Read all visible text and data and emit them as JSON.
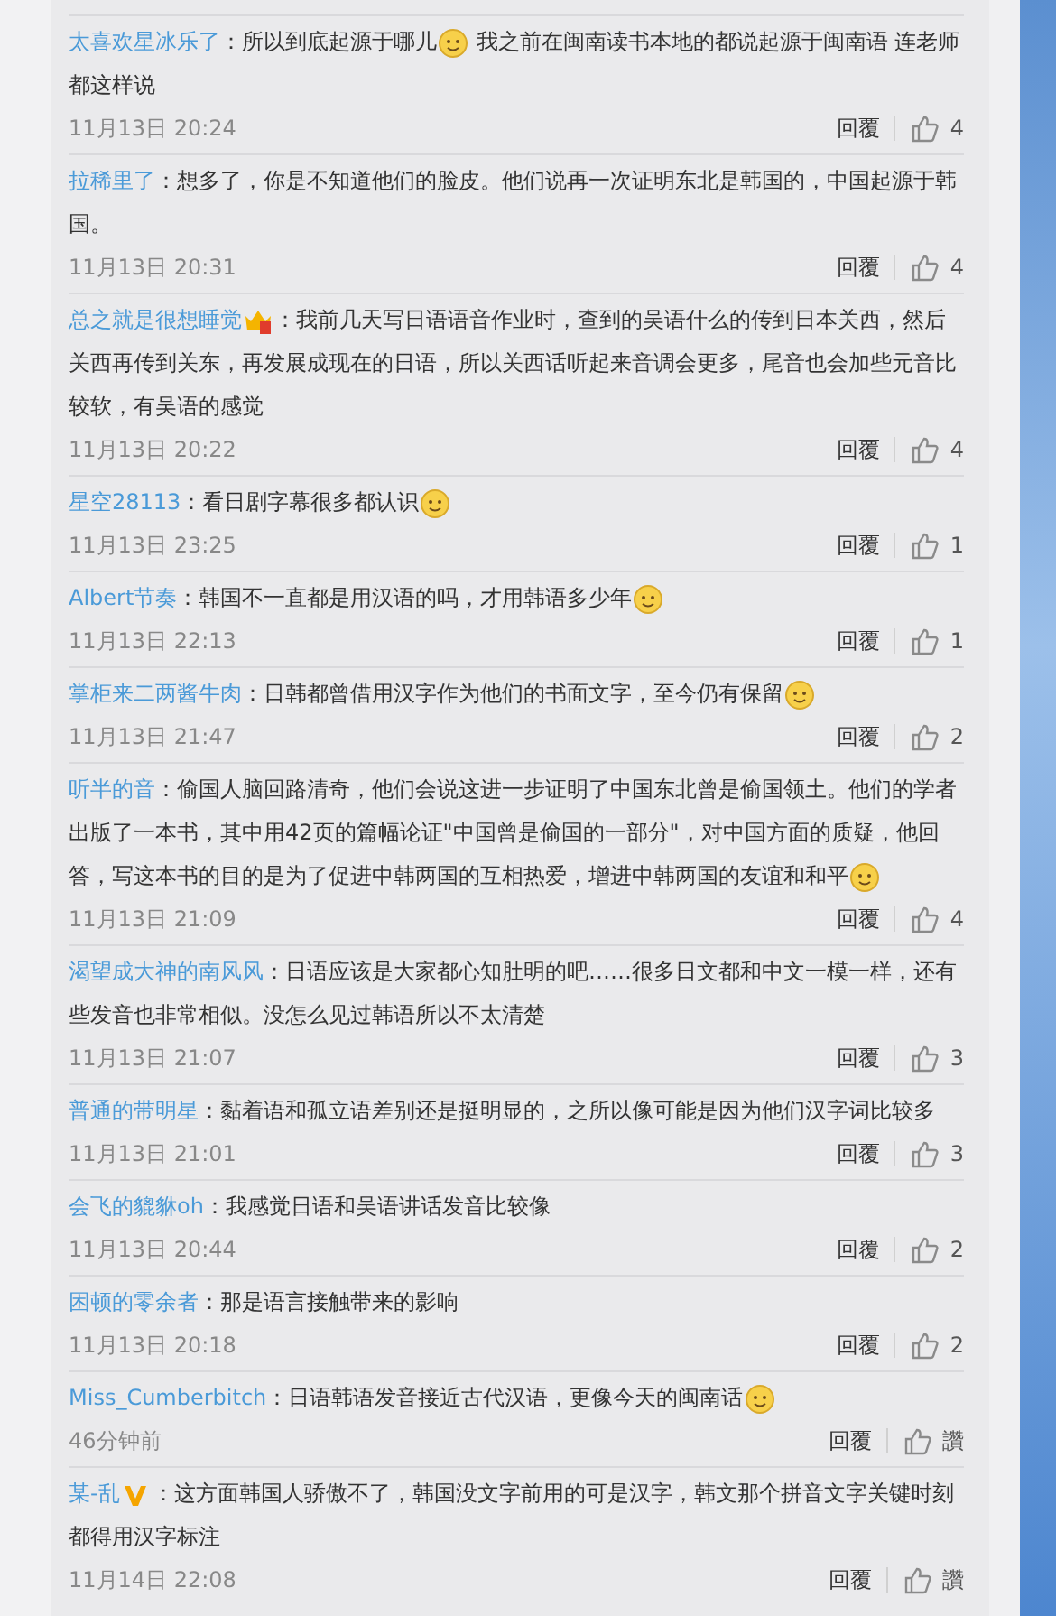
{
  "comments": [
    {
      "user": "太喜欢星冰乐了",
      "parts": [
        {
          "kind": "text",
          "text": "："
        },
        {
          "kind": "text",
          "text": "所以到底起源于哪儿"
        },
        {
          "kind": "emoji"
        },
        {
          "kind": "text",
          "text": " 我之前在闽南读书本地的都说起源于闽南语 连老师都这样说"
        }
      ],
      "time": "11月13日 20:24",
      "reply": "回覆",
      "likes": "4"
    },
    {
      "user": "拉稀里了",
      "parts": [
        {
          "kind": "text",
          "text": "："
        },
        {
          "kind": "text",
          "text": "想多了，你是不知道他们的脸皮。他们说再一次证明东北是韩国的，中国起源于韩国。"
        }
      ],
      "time": "11月13日 20:31",
      "reply": "回覆",
      "likes": "4"
    },
    {
      "user": "总之就是很想睡觉",
      "parts": [
        {
          "kind": "crown"
        },
        {
          "kind": "text",
          "text": "："
        },
        {
          "kind": "text",
          "text": "我前几天写日语语音作业时，查到的吴语什么的传到日本关西，然后关西再传到关东，再发展成现在的日语，所以关西话听起来音调会更多，尾音也会加些元音比较软，有吴语的感觉"
        }
      ],
      "time": "11月13日 20:22",
      "reply": "回覆",
      "likes": "4"
    },
    {
      "user": "星空28113",
      "parts": [
        {
          "kind": "text",
          "text": "："
        },
        {
          "kind": "text",
          "text": "看日剧字幕很多都认识"
        },
        {
          "kind": "emoji"
        }
      ],
      "time": "11月13日 23:25",
      "reply": "回覆",
      "likes": "1"
    },
    {
      "user": "Albert节奏",
      "parts": [
        {
          "kind": "text",
          "text": "："
        },
        {
          "kind": "text",
          "text": "韩国不一直都是用汉语的吗，才用韩语多少年"
        },
        {
          "kind": "emoji"
        }
      ],
      "time": "11月13日 22:13",
      "reply": "回覆",
      "likes": "1"
    },
    {
      "user": "掌柜来二两酱牛肉",
      "parts": [
        {
          "kind": "text",
          "text": "："
        },
        {
          "kind": "text",
          "text": "日韩都曾借用汉字作为他们的书面文字，至今仍有保留"
        },
        {
          "kind": "emoji"
        }
      ],
      "time": "11月13日 21:47",
      "reply": "回覆",
      "likes": "2"
    },
    {
      "user": "听半的音",
      "parts": [
        {
          "kind": "text",
          "text": "："
        },
        {
          "kind": "text",
          "text": "偷国人脑回路清奇，他们会说这进一步证明了中国东北曾是偷国领土。他们的学者出版了一本书，其中用42页的篇幅论证\"中国曾是偷国的一部分\"，对中国方面的质疑，他回答，写这本书的目的是为了促进中韩两国的互相热爱，增进中韩两国的友谊和和平"
        },
        {
          "kind": "emoji"
        }
      ],
      "time": "11月13日 21:09",
      "reply": "回覆",
      "likes": "4"
    },
    {
      "user": "渴望成大神的南风风",
      "parts": [
        {
          "kind": "text",
          "text": "："
        },
        {
          "kind": "text",
          "text": "日语应该是大家都心知肚明的吧……很多日文都和中文一模一样，还有些发音也非常相似。没怎么见过韩语所以不太清楚"
        }
      ],
      "time": "11月13日 21:07",
      "reply": "回覆",
      "likes": "3"
    },
    {
      "user": "普通的带明星",
      "parts": [
        {
          "kind": "text",
          "text": "："
        },
        {
          "kind": "text",
          "text": "黏着语和孤立语差别还是挺明显的，之所以像可能是因为他们汉字词比较多"
        }
      ],
      "time": "11月13日 21:01",
      "reply": "回覆",
      "likes": "3"
    },
    {
      "user": "会飞的貔貅oh",
      "parts": [
        {
          "kind": "text",
          "text": "："
        },
        {
          "kind": "text",
          "text": "我感觉日语和吴语讲话发音比较像"
        }
      ],
      "time": "11月13日 20:44",
      "reply": "回覆",
      "likes": "2"
    },
    {
      "user": "困顿的零余者",
      "parts": [
        {
          "kind": "text",
          "text": "："
        },
        {
          "kind": "text",
          "text": "那是语言接触带来的影响"
        }
      ],
      "time": "11月13日 20:18",
      "reply": "回覆",
      "likes": "2"
    },
    {
      "user": "Miss_Cumberbitch",
      "parts": [
        {
          "kind": "text",
          "text": "："
        },
        {
          "kind": "text",
          "text": "日语韩语发音接近古代汉语，更像今天的闽南话"
        },
        {
          "kind": "emoji"
        }
      ],
      "time": "46分钟前",
      "reply": "回覆",
      "likes": "讚"
    },
    {
      "user": "某-乱",
      "parts": [
        {
          "kind": "verified"
        },
        {
          "kind": "text",
          "text": "："
        },
        {
          "kind": "text",
          "text": "这方面韩国人骄傲不了，韩国没文字前用的可是汉字，韩文那个拼音文字关键时刻都得用汉字标注"
        }
      ],
      "time": "11月14日 22:08",
      "reply": "回覆",
      "likes": "讚"
    }
  ]
}
